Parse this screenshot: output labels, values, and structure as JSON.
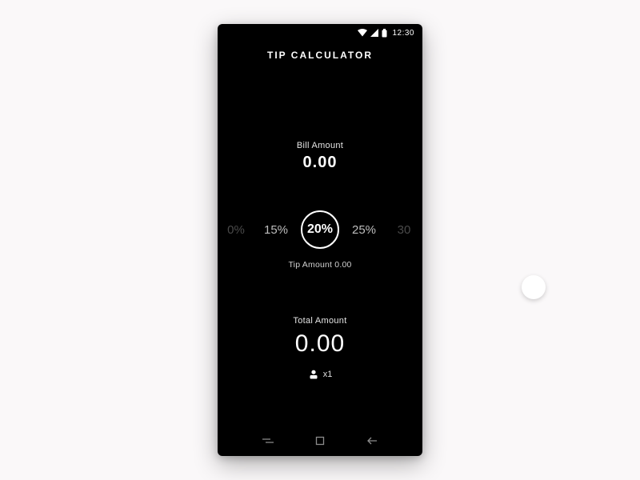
{
  "status": {
    "time": "12:30"
  },
  "app": {
    "title": "TIP CALCULATOR"
  },
  "bill": {
    "label": "Bill Amount",
    "value": "0.00"
  },
  "tips": {
    "options": [
      "0%",
      "15%",
      "20%",
      "25%",
      "30"
    ],
    "selected_index": 2,
    "amount_label": "Tip Amount 0.00"
  },
  "total": {
    "label": "Total Amount",
    "value": "0.00"
  },
  "people": {
    "count_label": "x1"
  }
}
